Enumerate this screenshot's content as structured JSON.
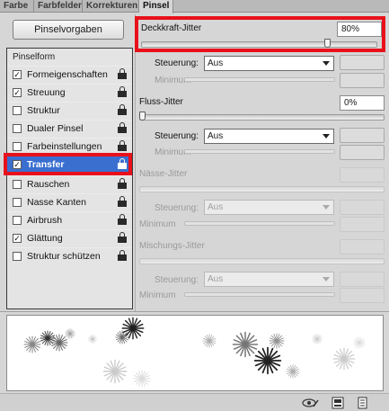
{
  "tabs": [
    "Farbe",
    "Farbfelder",
    "Korrekturen",
    "Pinsel"
  ],
  "active_tab": "Pinsel",
  "preset_button": "Pinselvorgaben",
  "brush_form_label": "Pinselform",
  "options": [
    {
      "label": "Formeigenschaften",
      "checked": true,
      "check_glyph": "✓"
    },
    {
      "label": "Streuung",
      "checked": true,
      "check_glyph": "✓"
    },
    {
      "label": "Struktur",
      "checked": false,
      "check_glyph": ""
    },
    {
      "label": "Dualer Pinsel",
      "checked": false,
      "check_glyph": ""
    },
    {
      "label": "Farbeinstellungen",
      "checked": false,
      "check_glyph": ""
    },
    {
      "label": "Transfer",
      "checked": true,
      "check_glyph": "✓",
      "selected": true
    },
    {
      "label": "Rauschen",
      "checked": false,
      "check_glyph": ""
    },
    {
      "label": "Nasse Kanten",
      "checked": false,
      "check_glyph": ""
    },
    {
      "label": "Airbrush",
      "checked": false,
      "check_glyph": ""
    },
    {
      "label": "Glättung",
      "checked": true,
      "check_glyph": "✓"
    },
    {
      "label": "Struktur schützen",
      "checked": false,
      "check_glyph": ""
    }
  ],
  "opacity_jitter": {
    "label": "Deckkraft-Jitter",
    "value": "80%",
    "level": 0.8,
    "control_label": "Steuerung:",
    "control_value": "Aus",
    "minimum_label": "Minimum"
  },
  "flow_jitter": {
    "label": "Fluss-Jitter",
    "value": "0%",
    "level": 0.0,
    "control_label": "Steuerung:",
    "control_value": "Aus",
    "minimum_label": "Minimum"
  },
  "wet_jitter": {
    "label": "Nässe-Jitter",
    "control_label": "Steuerung:",
    "control_value": "Aus",
    "minimum_label": "Minimum"
  },
  "mix_jitter": {
    "label": "Mischungs-Jitter",
    "control_label": "Steuerung:",
    "control_value": "Aus",
    "minimum_label": "Minimum"
  },
  "colors": {
    "highlight": "#e8111b",
    "selection": "#3a6fd0"
  },
  "bottom_icons": [
    "eye-icon",
    "new-preset-icon",
    "delete-icon"
  ]
}
